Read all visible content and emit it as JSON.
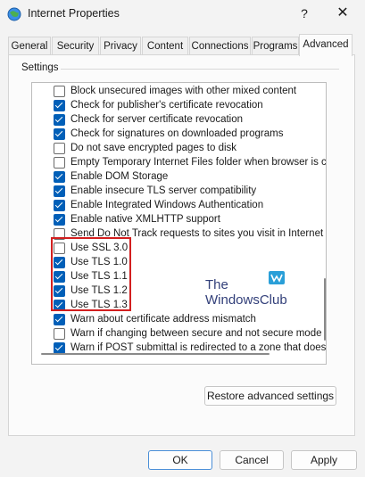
{
  "window": {
    "title": "Internet Properties",
    "help_glyph": "?",
    "close_glyph": "✕"
  },
  "tabs": [
    {
      "label": "General",
      "active": false
    },
    {
      "label": "Security",
      "active": false
    },
    {
      "label": "Privacy",
      "active": false
    },
    {
      "label": "Content",
      "active": false
    },
    {
      "label": "Connections",
      "active": false
    },
    {
      "label": "Programs",
      "active": false
    },
    {
      "label": "Advanced",
      "active": true
    }
  ],
  "settings": {
    "group_label": "Settings",
    "items": [
      {
        "label": "Block unsecured images with other mixed content",
        "checked": false
      },
      {
        "label": "Check for publisher's certificate revocation",
        "checked": true
      },
      {
        "label": "Check for server certificate revocation",
        "checked": true
      },
      {
        "label": "Check for signatures on downloaded programs",
        "checked": true
      },
      {
        "label": "Do not save encrypted pages to disk",
        "checked": false
      },
      {
        "label": "Empty Temporary Internet Files folder when browser is clo",
        "checked": false
      },
      {
        "label": "Enable DOM Storage",
        "checked": true
      },
      {
        "label": "Enable insecure TLS server compatibility",
        "checked": true
      },
      {
        "label": "Enable Integrated Windows Authentication",
        "checked": true
      },
      {
        "label": "Enable native XMLHTTP support",
        "checked": true
      },
      {
        "label": "Send Do Not Track requests to sites you visit in Internet E",
        "checked": false
      },
      {
        "label": "Use SSL 3.0",
        "checked": false
      },
      {
        "label": "Use TLS 1.0",
        "checked": true
      },
      {
        "label": "Use TLS 1.1",
        "checked": true
      },
      {
        "label": "Use TLS 1.2",
        "checked": true
      },
      {
        "label": "Use TLS 1.3",
        "checked": true
      },
      {
        "label": "Warn about certificate address mismatch",
        "checked": true
      },
      {
        "label": "Warn if changing between secure and not secure mode",
        "checked": false
      },
      {
        "label": "Warn if POST submittal is redirected to a zone that does n",
        "checked": true
      }
    ]
  },
  "watermark": {
    "line1": "The",
    "line2": "WindowsClub"
  },
  "buttons": {
    "restore": "Restore advanced settings",
    "ok": "OK",
    "cancel": "Cancel",
    "apply": "Apply"
  },
  "colors": {
    "accent": "#005fb8",
    "highlight_border": "#d21f1f"
  }
}
